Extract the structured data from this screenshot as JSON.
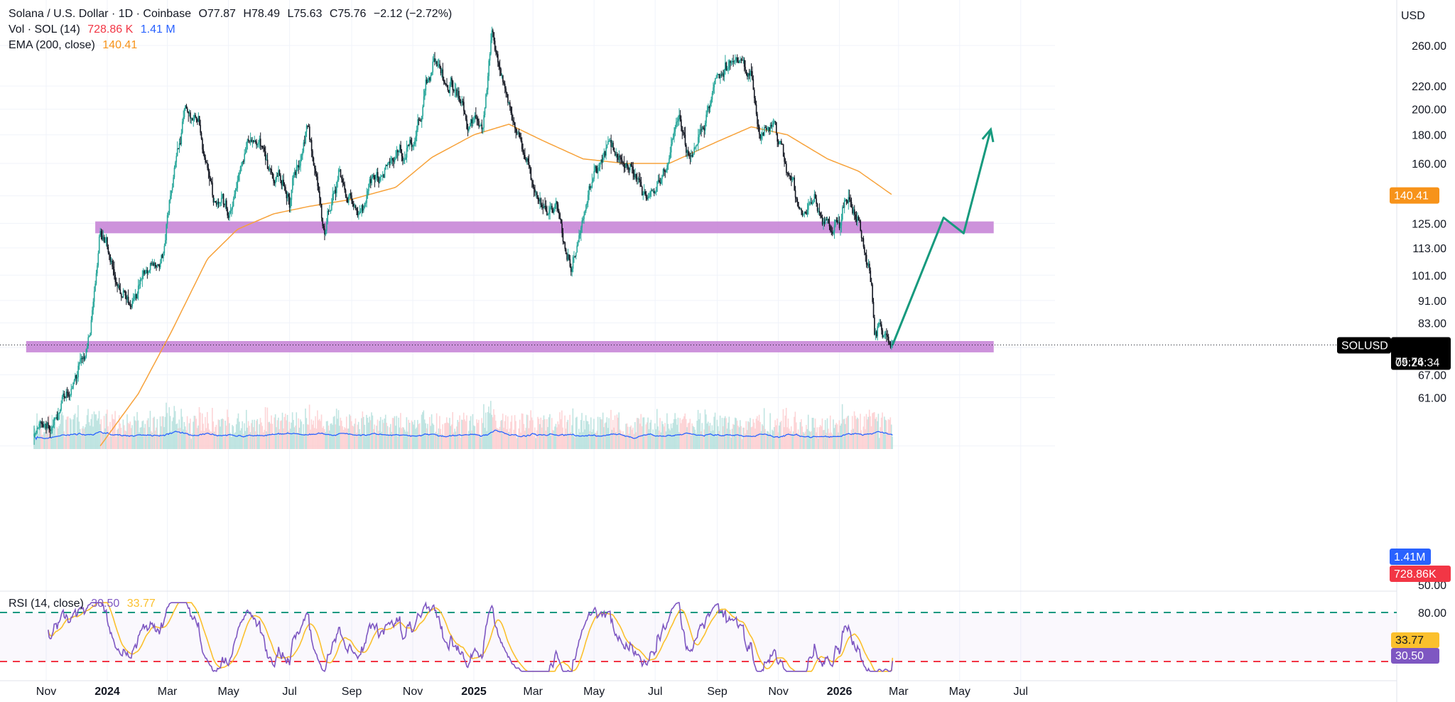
{
  "colors": {
    "up": "#26a69a",
    "down": "#131722",
    "ema": "#f7a23a",
    "zone": "#c47fd5",
    "arrow": "#179a7e",
    "volume_ma": "#2962ff",
    "rsi": "#7e57c2",
    "rsi_ma": "#fbc02d",
    "rsi_upper": "#089981",
    "rsi_lower": "#f23645"
  },
  "legend": {
    "symbol": "Solana / U.S. Dollar · 1D · Coinbase",
    "open": "O77.87",
    "high": "H78.49",
    "low": "L75.63",
    "close": "C75.76",
    "change": "−2.12 (−2.72%)",
    "vol_label": "Vol · SOL (14)",
    "vol_value": "728.86 K",
    "vol_ma_value": "1.41 M",
    "ema_label": "EMA (200, close)",
    "ema_value": "140.41"
  },
  "rsi_legend": {
    "label": "RSI (14, close)",
    "rsi_value": "30.50",
    "ma_value": "33.77"
  },
  "currency": "USD",
  "price_badges": {
    "ema": "140.41",
    "symbol": "SOLUSD",
    "last": "75.76",
    "countdown": "09:24:34",
    "vol_ma": "1.41M",
    "vol": "728.86K",
    "rsi_ma": "33.77",
    "rsi": "30.50"
  },
  "chart_data": {
    "type": "candlestick",
    "price_scale": "log",
    "price_axis_ticks": [
      "260.00",
      "220.00",
      "200.00",
      "180.00",
      "160.00",
      "140.00",
      "125.00",
      "113.00",
      "101.00",
      "91.00",
      "83.00",
      "75.00",
      "67.00",
      "61.00",
      "50.00"
    ],
    "rsi_axis_ticks": [
      "80.00"
    ],
    "time_axis_labels": [
      "Nov",
      "2024",
      "Mar",
      "May",
      "Jul",
      "Sep",
      "Nov",
      "2025",
      "Mar",
      "May",
      "Jul",
      "Sep",
      "Nov",
      "2026",
      "Mar",
      "May",
      "Jul"
    ],
    "price_waypoints": [
      {
        "date": "2023-10-20",
        "price": 52
      },
      {
        "date": "2023-11-05",
        "price": 55
      },
      {
        "date": "2023-11-20",
        "price": 60
      },
      {
        "date": "2023-12-05",
        "price": 70
      },
      {
        "date": "2023-12-15",
        "price": 78
      },
      {
        "date": "2023-12-25",
        "price": 122
      },
      {
        "date": "2024-01-05",
        "price": 105
      },
      {
        "date": "2024-01-20",
        "price": 92
      },
      {
        "date": "2024-02-05",
        "price": 98
      },
      {
        "date": "2024-02-25",
        "price": 112
      },
      {
        "date": "2024-03-18",
        "price": 205
      },
      {
        "date": "2024-04-01",
        "price": 195
      },
      {
        "date": "2024-04-15",
        "price": 140
      },
      {
        "date": "2024-05-01",
        "price": 135
      },
      {
        "date": "2024-05-20",
        "price": 180
      },
      {
        "date": "2024-06-01",
        "price": 170
      },
      {
        "date": "2024-06-15",
        "price": 145
      },
      {
        "date": "2024-07-01",
        "price": 140
      },
      {
        "date": "2024-07-20",
        "price": 185
      },
      {
        "date": "2024-08-05",
        "price": 120
      },
      {
        "date": "2024-08-20",
        "price": 150
      },
      {
        "date": "2024-09-06",
        "price": 130
      },
      {
        "date": "2024-09-25",
        "price": 155
      },
      {
        "date": "2024-10-15",
        "price": 160
      },
      {
        "date": "2024-11-01",
        "price": 170
      },
      {
        "date": "2024-11-22",
        "price": 255
      },
      {
        "date": "2024-12-10",
        "price": 225
      },
      {
        "date": "2024-12-25",
        "price": 185
      },
      {
        "date": "2025-01-10",
        "price": 190
      },
      {
        "date": "2025-01-19",
        "price": 270
      },
      {
        "date": "2025-02-01",
        "price": 220
      },
      {
        "date": "2025-02-20",
        "price": 170
      },
      {
        "date": "2025-03-10",
        "price": 130
      },
      {
        "date": "2025-03-25",
        "price": 135
      },
      {
        "date": "2025-04-08",
        "price": 102
      },
      {
        "date": "2025-04-25",
        "price": 145
      },
      {
        "date": "2025-05-15",
        "price": 175
      },
      {
        "date": "2025-06-01",
        "price": 160
      },
      {
        "date": "2025-06-22",
        "price": 135
      },
      {
        "date": "2025-07-10",
        "price": 160
      },
      {
        "date": "2025-07-25",
        "price": 195
      },
      {
        "date": "2025-08-05",
        "price": 165
      },
      {
        "date": "2025-08-25",
        "price": 200
      },
      {
        "date": "2025-09-18",
        "price": 245
      },
      {
        "date": "2025-10-05",
        "price": 225
      },
      {
        "date": "2025-10-12",
        "price": 185
      },
      {
        "date": "2025-10-28",
        "price": 195
      },
      {
        "date": "2025-11-10",
        "price": 155
      },
      {
        "date": "2025-11-22",
        "price": 130
      },
      {
        "date": "2025-12-10",
        "price": 135
      },
      {
        "date": "2025-12-25",
        "price": 122
      },
      {
        "date": "2026-01-10",
        "price": 143
      },
      {
        "date": "2026-01-22",
        "price": 125
      },
      {
        "date": "2026-02-02",
        "price": 100
      },
      {
        "date": "2026-02-05",
        "price": 80
      },
      {
        "date": "2026-02-10",
        "price": 84
      },
      {
        "date": "2026-02-18",
        "price": 80
      },
      {
        "date": "2026-02-23",
        "price": 75.76
      }
    ],
    "ema_200_waypoints": [
      {
        "date": "2023-12-25",
        "price": 50
      },
      {
        "date": "2024-02-01",
        "price": 62
      },
      {
        "date": "2024-03-05",
        "price": 80
      },
      {
        "date": "2024-04-10",
        "price": 108
      },
      {
        "date": "2024-05-10",
        "price": 122
      },
      {
        "date": "2024-06-15",
        "price": 130
      },
      {
        "date": "2024-07-20",
        "price": 134
      },
      {
        "date": "2024-09-01",
        "price": 138
      },
      {
        "date": "2024-10-15",
        "price": 145
      },
      {
        "date": "2024-11-20",
        "price": 164
      },
      {
        "date": "2025-01-01",
        "price": 180
      },
      {
        "date": "2025-02-05",
        "price": 188
      },
      {
        "date": "2025-03-10",
        "price": 176
      },
      {
        "date": "2025-04-20",
        "price": 163
      },
      {
        "date": "2025-06-01",
        "price": 160
      },
      {
        "date": "2025-07-15",
        "price": 160
      },
      {
        "date": "2025-09-01",
        "price": 175
      },
      {
        "date": "2025-10-05",
        "price": 186
      },
      {
        "date": "2025-11-10",
        "price": 180
      },
      {
        "date": "2025-12-20",
        "price": 163
      },
      {
        "date": "2026-01-20",
        "price": 155
      },
      {
        "date": "2026-02-23",
        "price": 140.41
      }
    ],
    "horizontal_zones": [
      {
        "low": 120,
        "high": 126,
        "from": "2023-12-20",
        "to": "2026-06-04"
      },
      {
        "low": 73.5,
        "high": 77,
        "from": "2023-10-12",
        "to": "2026-06-04"
      }
    ],
    "projection_arrow": [
      {
        "date": "2026-02-23",
        "price": 75.76
      },
      {
        "date": "2026-04-15",
        "price": 128
      },
      {
        "date": "2026-05-05",
        "price": 120
      },
      {
        "date": "2026-06-01",
        "price": 184
      }
    ],
    "last_price": 75.76,
    "rsi": {
      "period": 14,
      "last": 30.5,
      "ma_last": 33.77,
      "upper": 80,
      "lower": 30
    },
    "volume": {
      "last": "728.86K",
      "ma_last": "1.41M"
    }
  }
}
